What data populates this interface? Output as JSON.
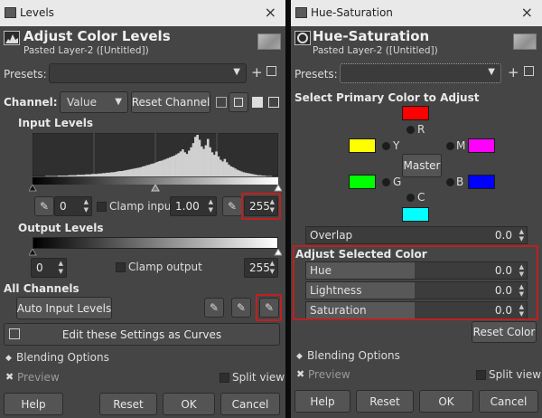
{
  "levels": {
    "window_title": "Levels",
    "close_icon": "×",
    "header_title": "Adjust Color Levels",
    "header_subtitle": "Pasted Layer-2 ([Untitled])",
    "presets_label": "Presets:",
    "presets_value": "",
    "channel_label": "Channel:",
    "channel_value": "Value",
    "reset_channel": "Reset Channel",
    "input_levels_label": "Input Levels",
    "input_low": "0",
    "clamp_input": "Clamp input",
    "gamma": "1.00",
    "input_high": "255",
    "output_levels_label": "Output Levels",
    "output_low": "0",
    "clamp_output": "Clamp output",
    "output_high": "255",
    "all_channels_label": "All Channels",
    "auto_input_levels": "Auto Input Levels",
    "edit_as_curves": "Edit these Settings as Curves",
    "blending_options": "Blending Options",
    "preview": "Preview",
    "split_view": "Split view",
    "help": "Help",
    "reset": "Reset",
    "ok": "OK",
    "cancel": "Cancel",
    "histogram": [
      0,
      0,
      0,
      0,
      0,
      0,
      1,
      1,
      1,
      1,
      1,
      1,
      2,
      2,
      2,
      2,
      2,
      3,
      3,
      3,
      3,
      4,
      4,
      4,
      4,
      5,
      5,
      5,
      6,
      6,
      6,
      7,
      7,
      8,
      8,
      9,
      9,
      10,
      10,
      11,
      12,
      13,
      13,
      14,
      15,
      16,
      17,
      18,
      19,
      20,
      21,
      22,
      24,
      25,
      27,
      28,
      30,
      31,
      33,
      35,
      37,
      38,
      40,
      42,
      44,
      46,
      48,
      50,
      53,
      56,
      60,
      65,
      58,
      54,
      62,
      70,
      80,
      95,
      100,
      88,
      72,
      66,
      75,
      90,
      70,
      58,
      52,
      60,
      48,
      40,
      36,
      42,
      34,
      28,
      24,
      22,
      19,
      16,
      14,
      12,
      10,
      9,
      8,
      7,
      6,
      5,
      4,
      3,
      3,
      2,
      2,
      1,
      1,
      1,
      0,
      0,
      0
    ]
  },
  "huesat": {
    "window_title": "Hue-Saturation",
    "close_icon": "×",
    "header_title": "Hue-Saturation",
    "header_subtitle": "Pasted Layer-2 ([Untitled])",
    "presets_label": "Presets:",
    "presets_value": "",
    "primary_color_label": "Select Primary Color to Adjust",
    "master": "Master",
    "colors": {
      "R": {
        "label": "R",
        "hex": "#ff0000"
      },
      "Y": {
        "label": "Y",
        "hex": "#ffff00"
      },
      "G": {
        "label": "G",
        "hex": "#00ff00"
      },
      "C": {
        "label": "C",
        "hex": "#00ffff"
      },
      "B": {
        "label": "B",
        "hex": "#0000ff"
      },
      "M": {
        "label": "M",
        "hex": "#ff00ff"
      }
    },
    "overlap_label": "Overlap",
    "overlap_value": "0.0",
    "adjust_selected_label": "Adjust Selected Color",
    "hue_label": "Hue",
    "hue_value": "0.0",
    "lightness_label": "Lightness",
    "lightness_value": "0.0",
    "saturation_label": "Saturation",
    "saturation_value": "0.0",
    "reset_color": "Reset Color",
    "blending_options": "Blending Options",
    "preview": "Preview",
    "split_view": "Split view",
    "help": "Help",
    "reset": "Reset",
    "ok": "OK",
    "cancel": "Cancel"
  },
  "colors": {
    "dialog_bg": "#454545",
    "titlebar_bg": "#e9e9e9",
    "highlight_red": "#c0201f"
  }
}
